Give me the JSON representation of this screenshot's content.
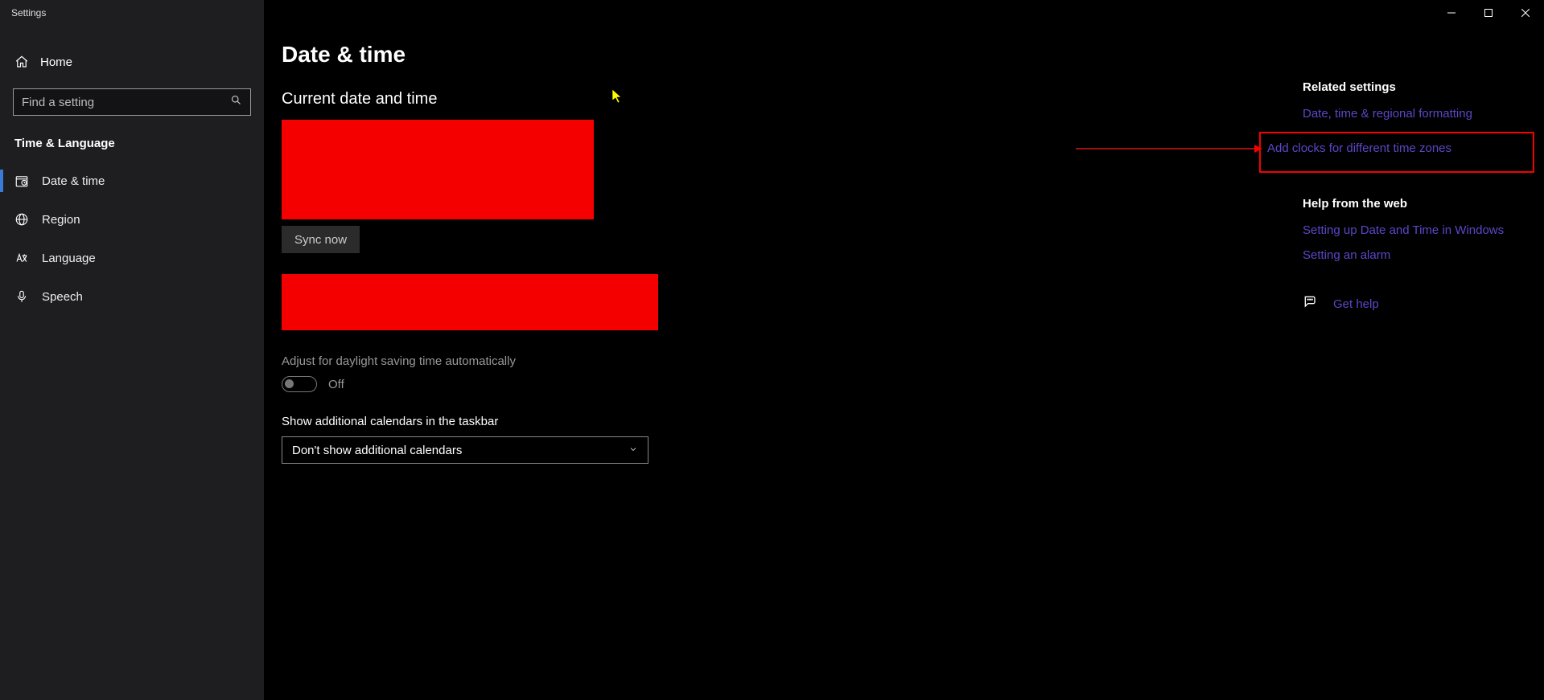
{
  "window": {
    "title": "Settings"
  },
  "sidebar": {
    "home": "Home",
    "search_placeholder": "Find a setting",
    "section": "Time & Language",
    "items": [
      {
        "label": "Date & time",
        "active": true,
        "icon": "clock"
      },
      {
        "label": "Region",
        "active": false,
        "icon": "globe"
      },
      {
        "label": "Language",
        "active": false,
        "icon": "language"
      },
      {
        "label": "Speech",
        "active": false,
        "icon": "mic"
      }
    ]
  },
  "main": {
    "title": "Date & time",
    "current_heading": "Current date and time",
    "sync_btn": "Sync now",
    "daylight_label": "Adjust for daylight saving time automatically",
    "daylight_state": "Off",
    "calendar_label": "Show additional calendars in the taskbar",
    "calendar_value": "Don't show additional calendars"
  },
  "right": {
    "related_heading": "Related settings",
    "link_formatting": "Date, time & regional formatting",
    "link_addclocks": "Add clocks for different time zones",
    "help_heading": "Help from the web",
    "link_setup": "Setting up Date and Time in Windows",
    "link_alarm": "Setting an alarm",
    "get_help": "Get help"
  }
}
